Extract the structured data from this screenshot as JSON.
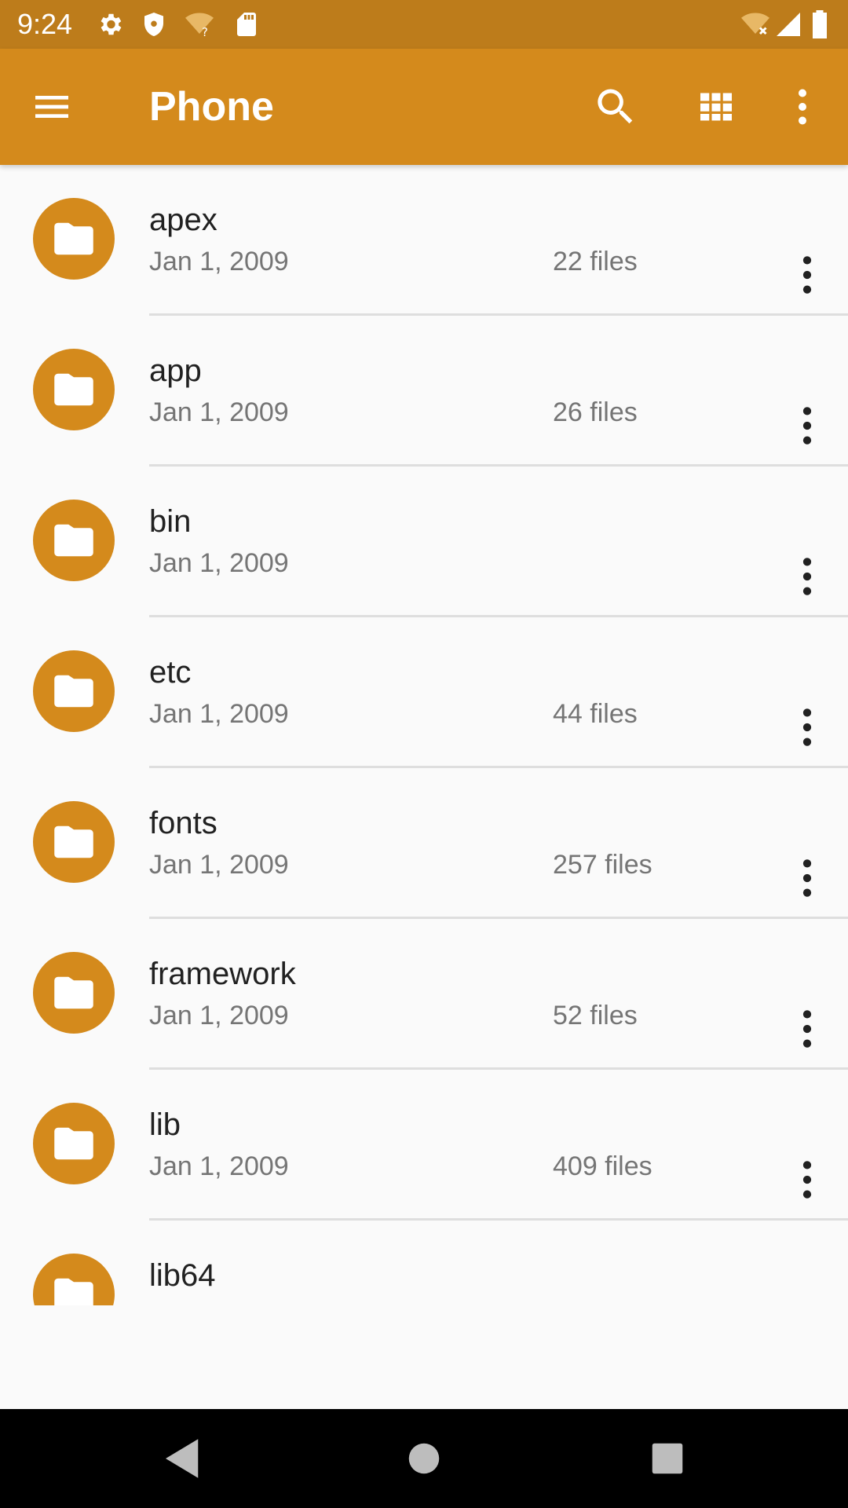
{
  "status_bar": {
    "time": "9:24",
    "left_icons": [
      "gear-icon",
      "shield-icon",
      "wifi-unknown-icon",
      "sd-card-icon"
    ],
    "right_icons": [
      "wifi-off-icon",
      "cell-signal-icon",
      "battery-icon"
    ]
  },
  "app_bar": {
    "title": "Phone",
    "actions": [
      "search-icon",
      "grid-view-icon",
      "more-vert-icon"
    ]
  },
  "files": [
    {
      "name": "apex",
      "date": "Jan 1, 2009",
      "count": "22 files"
    },
    {
      "name": "app",
      "date": "Jan 1, 2009",
      "count": "26 files"
    },
    {
      "name": "bin",
      "date": "Jan 1, 2009",
      "count": ""
    },
    {
      "name": "etc",
      "date": "Jan 1, 2009",
      "count": "44 files"
    },
    {
      "name": "fonts",
      "date": "Jan 1, 2009",
      "count": "257 files"
    },
    {
      "name": "framework",
      "date": "Jan 1, 2009",
      "count": "52 files"
    },
    {
      "name": "lib",
      "date": "Jan 1, 2009",
      "count": "409 files"
    },
    {
      "name": "lib64",
      "date": "",
      "count": ""
    }
  ],
  "nav_bar": {
    "buttons": [
      "back-icon",
      "home-icon",
      "recents-icon"
    ]
  },
  "colors": {
    "status_bar": "#bd7c1b",
    "app_bar": "#d48a1c",
    "accent": "#d48a1c",
    "background": "#fafafa"
  }
}
